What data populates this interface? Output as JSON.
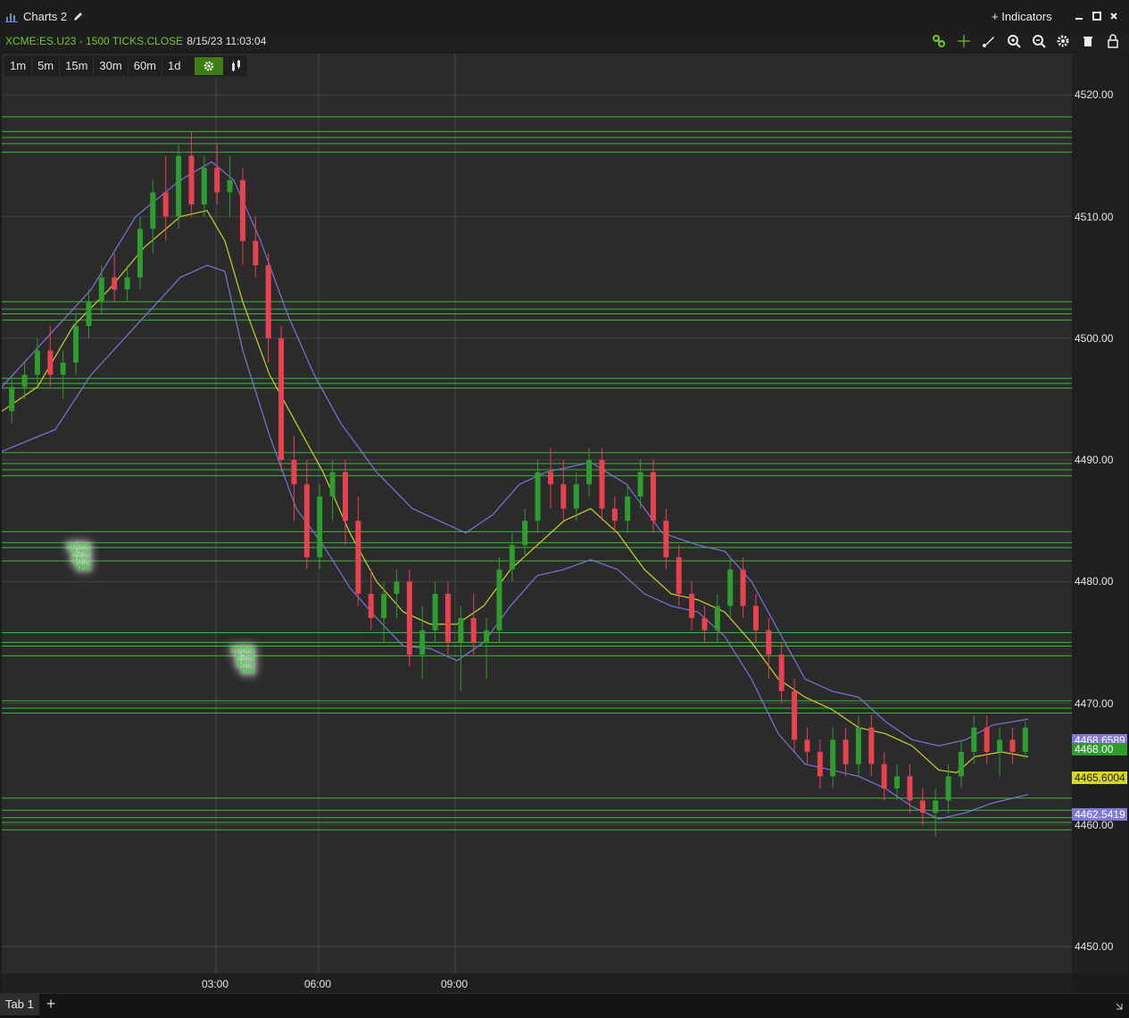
{
  "window": {
    "title": "Charts 2",
    "indicators_label": "+ Indicators"
  },
  "infobar": {
    "symbol": "XCME:ES.U23 - 1500 TICKS.CLOSE",
    "timestamp": "8/15/23 11:03:04"
  },
  "timeframes": [
    "1m",
    "5m",
    "15m",
    "30m",
    "60m",
    "1d"
  ],
  "tabs": {
    "active": "Tab 1"
  },
  "fib_labels": [
    "100%",
    "62%",
    "38%",
    "0%"
  ],
  "price_tags": {
    "upper_band": "4468.6589",
    "last": "4468.00",
    "ma": "4465.6004",
    "lower_band": "4462.5419"
  },
  "colors": {
    "bull": "#2e9c2e",
    "bear": "#e8414f",
    "ma": "#cfcf2a",
    "band": "#7b74d6",
    "levels": "#3fc43f",
    "accent": "#76c42a"
  },
  "chart_data": {
    "type": "candlestick",
    "yticks": [
      4450,
      4460,
      4470,
      4480,
      4490,
      4500,
      4510,
      4520
    ],
    "ytick_labels": [
      "4450.00",
      "4460.00",
      "4470.00",
      "4480.00",
      "4490.00",
      "4500.00",
      "4510.00",
      "4520.00"
    ],
    "ylim": [
      4447.8,
      4523.4
    ],
    "xtick_labels": [
      "03:00",
      "06:00",
      "09:00"
    ],
    "grid": true,
    "horizontal_levels": [
      4518.2,
      4517.0,
      4516.5,
      4516.0,
      4515.3,
      4503.0,
      4502.4,
      4502.0,
      4501.5,
      4496.7,
      4496.3,
      4495.9,
      4490.6,
      4489.7,
      4489.2,
      4488.7,
      4484.1,
      4483.2,
      4482.8,
      4481.7,
      4475.8,
      4475.0,
      4474.7,
      4473.9,
      4470.2,
      4469.6,
      4469.2,
      4462.2,
      4461.2,
      4460.6,
      4460.2,
      4459.6
    ],
    "ma": [
      [
        0,
        4494
      ],
      [
        40,
        4496
      ],
      [
        80,
        4501
      ],
      [
        120,
        4504
      ],
      [
        160,
        4507.5
      ],
      [
        200,
        4510
      ],
      [
        230,
        4510.5
      ],
      [
        250,
        4508
      ],
      [
        270,
        4503
      ],
      [
        300,
        4497
      ],
      [
        330,
        4493
      ],
      [
        360,
        4489
      ],
      [
        390,
        4484
      ],
      [
        420,
        4480
      ],
      [
        450,
        4477.5
      ],
      [
        480,
        4476.5
      ],
      [
        510,
        4476.5
      ],
      [
        540,
        4478
      ],
      [
        570,
        4481
      ],
      [
        600,
        4483
      ],
      [
        630,
        4485
      ],
      [
        660,
        4486
      ],
      [
        690,
        4484
      ],
      [
        720,
        4481
      ],
      [
        750,
        4479
      ],
      [
        780,
        4478.5
      ],
      [
        810,
        4477.5
      ],
      [
        840,
        4475
      ],
      [
        870,
        4472
      ],
      [
        900,
        4470.5
      ],
      [
        930,
        4469.5
      ],
      [
        960,
        4468
      ],
      [
        990,
        4467.5
      ],
      [
        1020,
        4466.5
      ],
      [
        1050,
        4464.5
      ],
      [
        1070,
        4464.3
      ],
      [
        1090,
        4465.6
      ],
      [
        1120,
        4466
      ],
      [
        1150,
        4465.6
      ]
    ],
    "upper_band": [
      [
        0,
        4496
      ],
      [
        50,
        4500
      ],
      [
        100,
        4504
      ],
      [
        150,
        4510
      ],
      [
        200,
        4513
      ],
      [
        235,
        4514.5
      ],
      [
        260,
        4513
      ],
      [
        290,
        4508
      ],
      [
        320,
        4502
      ],
      [
        350,
        4497
      ],
      [
        380,
        4493
      ],
      [
        420,
        4489
      ],
      [
        460,
        4486
      ],
      [
        490,
        4485
      ],
      [
        520,
        4484
      ],
      [
        550,
        4485.5
      ],
      [
        580,
        4488
      ],
      [
        610,
        4489
      ],
      [
        660,
        4489.8
      ],
      [
        700,
        4488
      ],
      [
        740,
        4484
      ],
      [
        780,
        4483
      ],
      [
        810,
        4482.5
      ],
      [
        840,
        4480
      ],
      [
        870,
        4476
      ],
      [
        900,
        4472
      ],
      [
        930,
        4471
      ],
      [
        960,
        4470.5
      ],
      [
        990,
        4468.5
      ],
      [
        1020,
        4467
      ],
      [
        1050,
        4466.5
      ],
      [
        1080,
        4467
      ],
      [
        1110,
        4468.2
      ],
      [
        1150,
        4468.7
      ]
    ],
    "lower_band": [
      [
        0,
        4490.7
      ],
      [
        60,
        4492.5
      ],
      [
        100,
        4497
      ],
      [
        150,
        4501
      ],
      [
        200,
        4505
      ],
      [
        230,
        4506
      ],
      [
        250,
        4505.5
      ],
      [
        270,
        4499
      ],
      [
        300,
        4492
      ],
      [
        330,
        4486
      ],
      [
        360,
        4483
      ],
      [
        390,
        4479.5
      ],
      [
        420,
        4477
      ],
      [
        450,
        4474.7
      ],
      [
        480,
        4474.5
      ],
      [
        510,
        4473.5
      ],
      [
        540,
        4475
      ],
      [
        570,
        4478
      ],
      [
        600,
        4480.5
      ],
      [
        630,
        4481
      ],
      [
        660,
        4481.8
      ],
      [
        690,
        4481
      ],
      [
        720,
        4479
      ],
      [
        750,
        4478
      ],
      [
        780,
        4477.5
      ],
      [
        810,
        4475.5
      ],
      [
        840,
        4472
      ],
      [
        870,
        4467.5
      ],
      [
        900,
        4465
      ],
      [
        930,
        4464.5
      ],
      [
        960,
        4464
      ],
      [
        990,
        4463
      ],
      [
        1020,
        4461.5
      ],
      [
        1050,
        4460.5
      ],
      [
        1080,
        4461
      ],
      [
        1110,
        4461.8
      ],
      [
        1150,
        4462.5
      ]
    ],
    "candles": [
      [
        4494,
        4497,
        4493,
        4496
      ],
      [
        4496,
        4498,
        4495,
        4497
      ],
      [
        4497,
        4500,
        4496,
        4499
      ],
      [
        4499,
        4501,
        4496,
        4497
      ],
      [
        4497,
        4499,
        4495,
        4498
      ],
      [
        4498,
        4502,
        4497,
        4501
      ],
      [
        4501,
        4504,
        4500,
        4503
      ],
      [
        4503,
        4506,
        4502,
        4505
      ],
      [
        4505,
        4507,
        4503,
        4504
      ],
      [
        4504,
        4506,
        4503,
        4505
      ],
      [
        4505,
        4510,
        4504,
        4509
      ],
      [
        4509,
        4513,
        4507,
        4512
      ],
      [
        4512,
        4515,
        4508,
        4510
      ],
      [
        4510,
        4516,
        4509,
        4515
      ],
      [
        4515,
        4517,
        4510,
        4511
      ],
      [
        4511,
        4515,
        4510,
        4514
      ],
      [
        4514,
        4516,
        4511,
        4512
      ],
      [
        4512,
        4515,
        4510,
        4513
      ],
      [
        4513,
        4514,
        4506,
        4508
      ],
      [
        4508,
        4510,
        4505,
        4506
      ],
      [
        4506,
        4507,
        4498,
        4500
      ],
      [
        4500,
        4501,
        4489,
        4490
      ],
      [
        4490,
        4492,
        4485,
        4488
      ],
      [
        4488,
        4490,
        4481,
        4482
      ],
      [
        4482,
        4488,
        4481,
        4487
      ],
      [
        4487,
        4490,
        4485,
        4489
      ],
      [
        4489,
        4490,
        4483,
        4485
      ],
      [
        4485,
        4487,
        4478,
        4479
      ],
      [
        4479,
        4481,
        4476,
        4477
      ],
      [
        4477,
        4480,
        4475,
        4479
      ],
      [
        4479,
        4481,
        4477,
        4480
      ],
      [
        4480,
        4481,
        4473,
        4474
      ],
      [
        4474,
        4478,
        4472,
        4476
      ],
      [
        4476,
        4480,
        4475,
        4479
      ],
      [
        4479,
        4480,
        4474,
        4475
      ],
      [
        4475,
        4478,
        4471,
        4477
      ],
      [
        4477,
        4479,
        4474,
        4475
      ],
      [
        4475,
        4477,
        4472,
        4476
      ],
      [
        4476,
        4482,
        4475,
        4481
      ],
      [
        4481,
        4484,
        4480,
        4483
      ],
      [
        4483,
        4486,
        4482,
        4485
      ],
      [
        4485,
        4490,
        4484,
        4489
      ],
      [
        4489,
        4491,
        4486,
        4488
      ],
      [
        4488,
        4490,
        4485,
        4486
      ],
      [
        4486,
        4489,
        4485,
        4488
      ],
      [
        4488,
        4491,
        4487,
        4490
      ],
      [
        4490,
        4491,
        4485,
        4486
      ],
      [
        4486,
        4487,
        4484,
        4485
      ],
      [
        4485,
        4488,
        4484,
        4487
      ],
      [
        4487,
        4490,
        4486,
        4489
      ],
      [
        4489,
        4490,
        4484,
        4485
      ],
      [
        4485,
        4486,
        4481,
        4482
      ],
      [
        4482,
        4483,
        4478,
        4479
      ],
      [
        4479,
        4480,
        4476,
        4477
      ],
      [
        4477,
        4478,
        4475,
        4476
      ],
      [
        4476,
        4479,
        4475,
        4478
      ],
      [
        4478,
        4482,
        4477,
        4481
      ],
      [
        4481,
        4482,
        4477,
        4478
      ],
      [
        4478,
        4479,
        4475,
        4476
      ],
      [
        4476,
        4477,
        4472,
        4474
      ],
      [
        4474,
        4475,
        4470,
        4471
      ],
      [
        4471,
        4472,
        4466,
        4467
      ],
      [
        4467,
        4468,
        4465,
        4466
      ],
      [
        4466,
        4467,
        4463,
        4464
      ],
      [
        4464,
        4468,
        4463,
        4467
      ],
      [
        4467,
        4468,
        4464,
        4465
      ],
      [
        4465,
        4469,
        4464,
        4468
      ],
      [
        4468,
        4469,
        4464,
        4465
      ],
      [
        4465,
        4466,
        4462,
        4463
      ],
      [
        4463,
        4465,
        4462,
        4464
      ],
      [
        4464,
        4465,
        4461,
        4462
      ],
      [
        4462,
        4463,
        4460,
        4461
      ],
      [
        4461,
        4463,
        4459,
        4462
      ],
      [
        4462,
        4465,
        4461,
        4464
      ],
      [
        4464,
        4467,
        4463,
        4466
      ],
      [
        4466,
        4469,
        4465,
        4468
      ],
      [
        4468,
        4469,
        4465,
        4466
      ],
      [
        4466,
        4468,
        4464,
        4467
      ],
      [
        4467,
        4468,
        4465,
        4466
      ],
      [
        4466,
        4468.5,
        4465.5,
        4468
      ]
    ]
  }
}
